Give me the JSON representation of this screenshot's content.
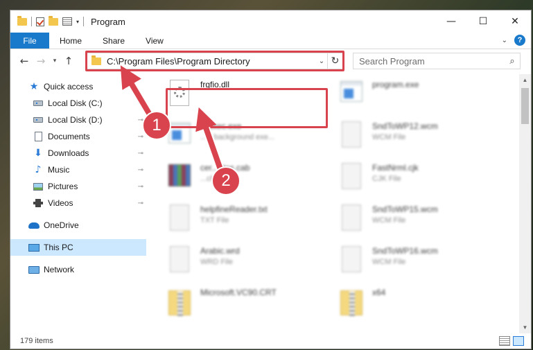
{
  "window": {
    "title": "Program",
    "controls": {
      "minimize": "—",
      "maximize": "☐",
      "close": "✕"
    }
  },
  "ribbon": {
    "file": "File",
    "tabs": [
      "Home",
      "Share",
      "View"
    ]
  },
  "address": {
    "path": "C:\\Program Files\\Program Directory"
  },
  "search": {
    "placeholder": "Search Program"
  },
  "sidebar": {
    "items": [
      {
        "label": "Quick access",
        "icon": "star-icon"
      },
      {
        "label": "Local Disk (C:)",
        "icon": "drive-icon",
        "pinned": true
      },
      {
        "label": "Local Disk (D:)",
        "icon": "drive-icon",
        "pinned": true
      },
      {
        "label": "Documents",
        "icon": "documents-icon",
        "pinned": true
      },
      {
        "label": "Downloads",
        "icon": "download-icon",
        "pinned": true
      },
      {
        "label": "Music",
        "icon": "music-icon",
        "pinned": true
      },
      {
        "label": "Pictures",
        "icon": "pictures-icon",
        "pinned": true
      },
      {
        "label": "Videos",
        "icon": "videos-icon",
        "pinned": true
      },
      {
        "label": "OneDrive",
        "icon": "onedrive-icon"
      },
      {
        "label": "This PC",
        "icon": "this-pc-icon",
        "selected": true
      },
      {
        "label": "Network",
        "icon": "network-icon"
      }
    ],
    "pin_glyph": "📌"
  },
  "files": [
    {
      "name": "frgfio.dll",
      "type": "",
      "icon": "dll-file-icon"
    },
    {
      "name": "program.exe",
      "type": "",
      "icon": "exe-file-icon"
    },
    {
      "name": "...Exec.exe",
      "type": "...V background exe...",
      "icon": "exe-file-icon"
    },
    {
      "name": "SndToWP12.wcm",
      "type": "WCM File",
      "icon": "file-icon"
    },
    {
      "name": "cer...ates.cab",
      "type": "...chow",
      "icon": "archive-icon"
    },
    {
      "name": "FastNrml.cjk",
      "type": "CJK File",
      "icon": "file-icon"
    },
    {
      "name": "helpfineReader.txt",
      "type": "TXT File",
      "icon": "file-icon"
    },
    {
      "name": "SndToWP15.wcm",
      "type": "WCM File",
      "icon": "file-icon"
    },
    {
      "name": "Arabic.wrd",
      "type": "WRD File",
      "icon": "file-icon"
    },
    {
      "name": "SndToWP16.wcm",
      "type": "WCM File",
      "icon": "file-icon"
    },
    {
      "name": "Microsoft.VC90.CRT",
      "type": "",
      "icon": "zip-folder-icon"
    },
    {
      "name": "x64",
      "type": "",
      "icon": "zip-folder-icon"
    }
  ],
  "status": {
    "item_count": "179 items"
  },
  "annotations": {
    "badge1": "1",
    "badge2": "2",
    "color": "#d9434d"
  }
}
